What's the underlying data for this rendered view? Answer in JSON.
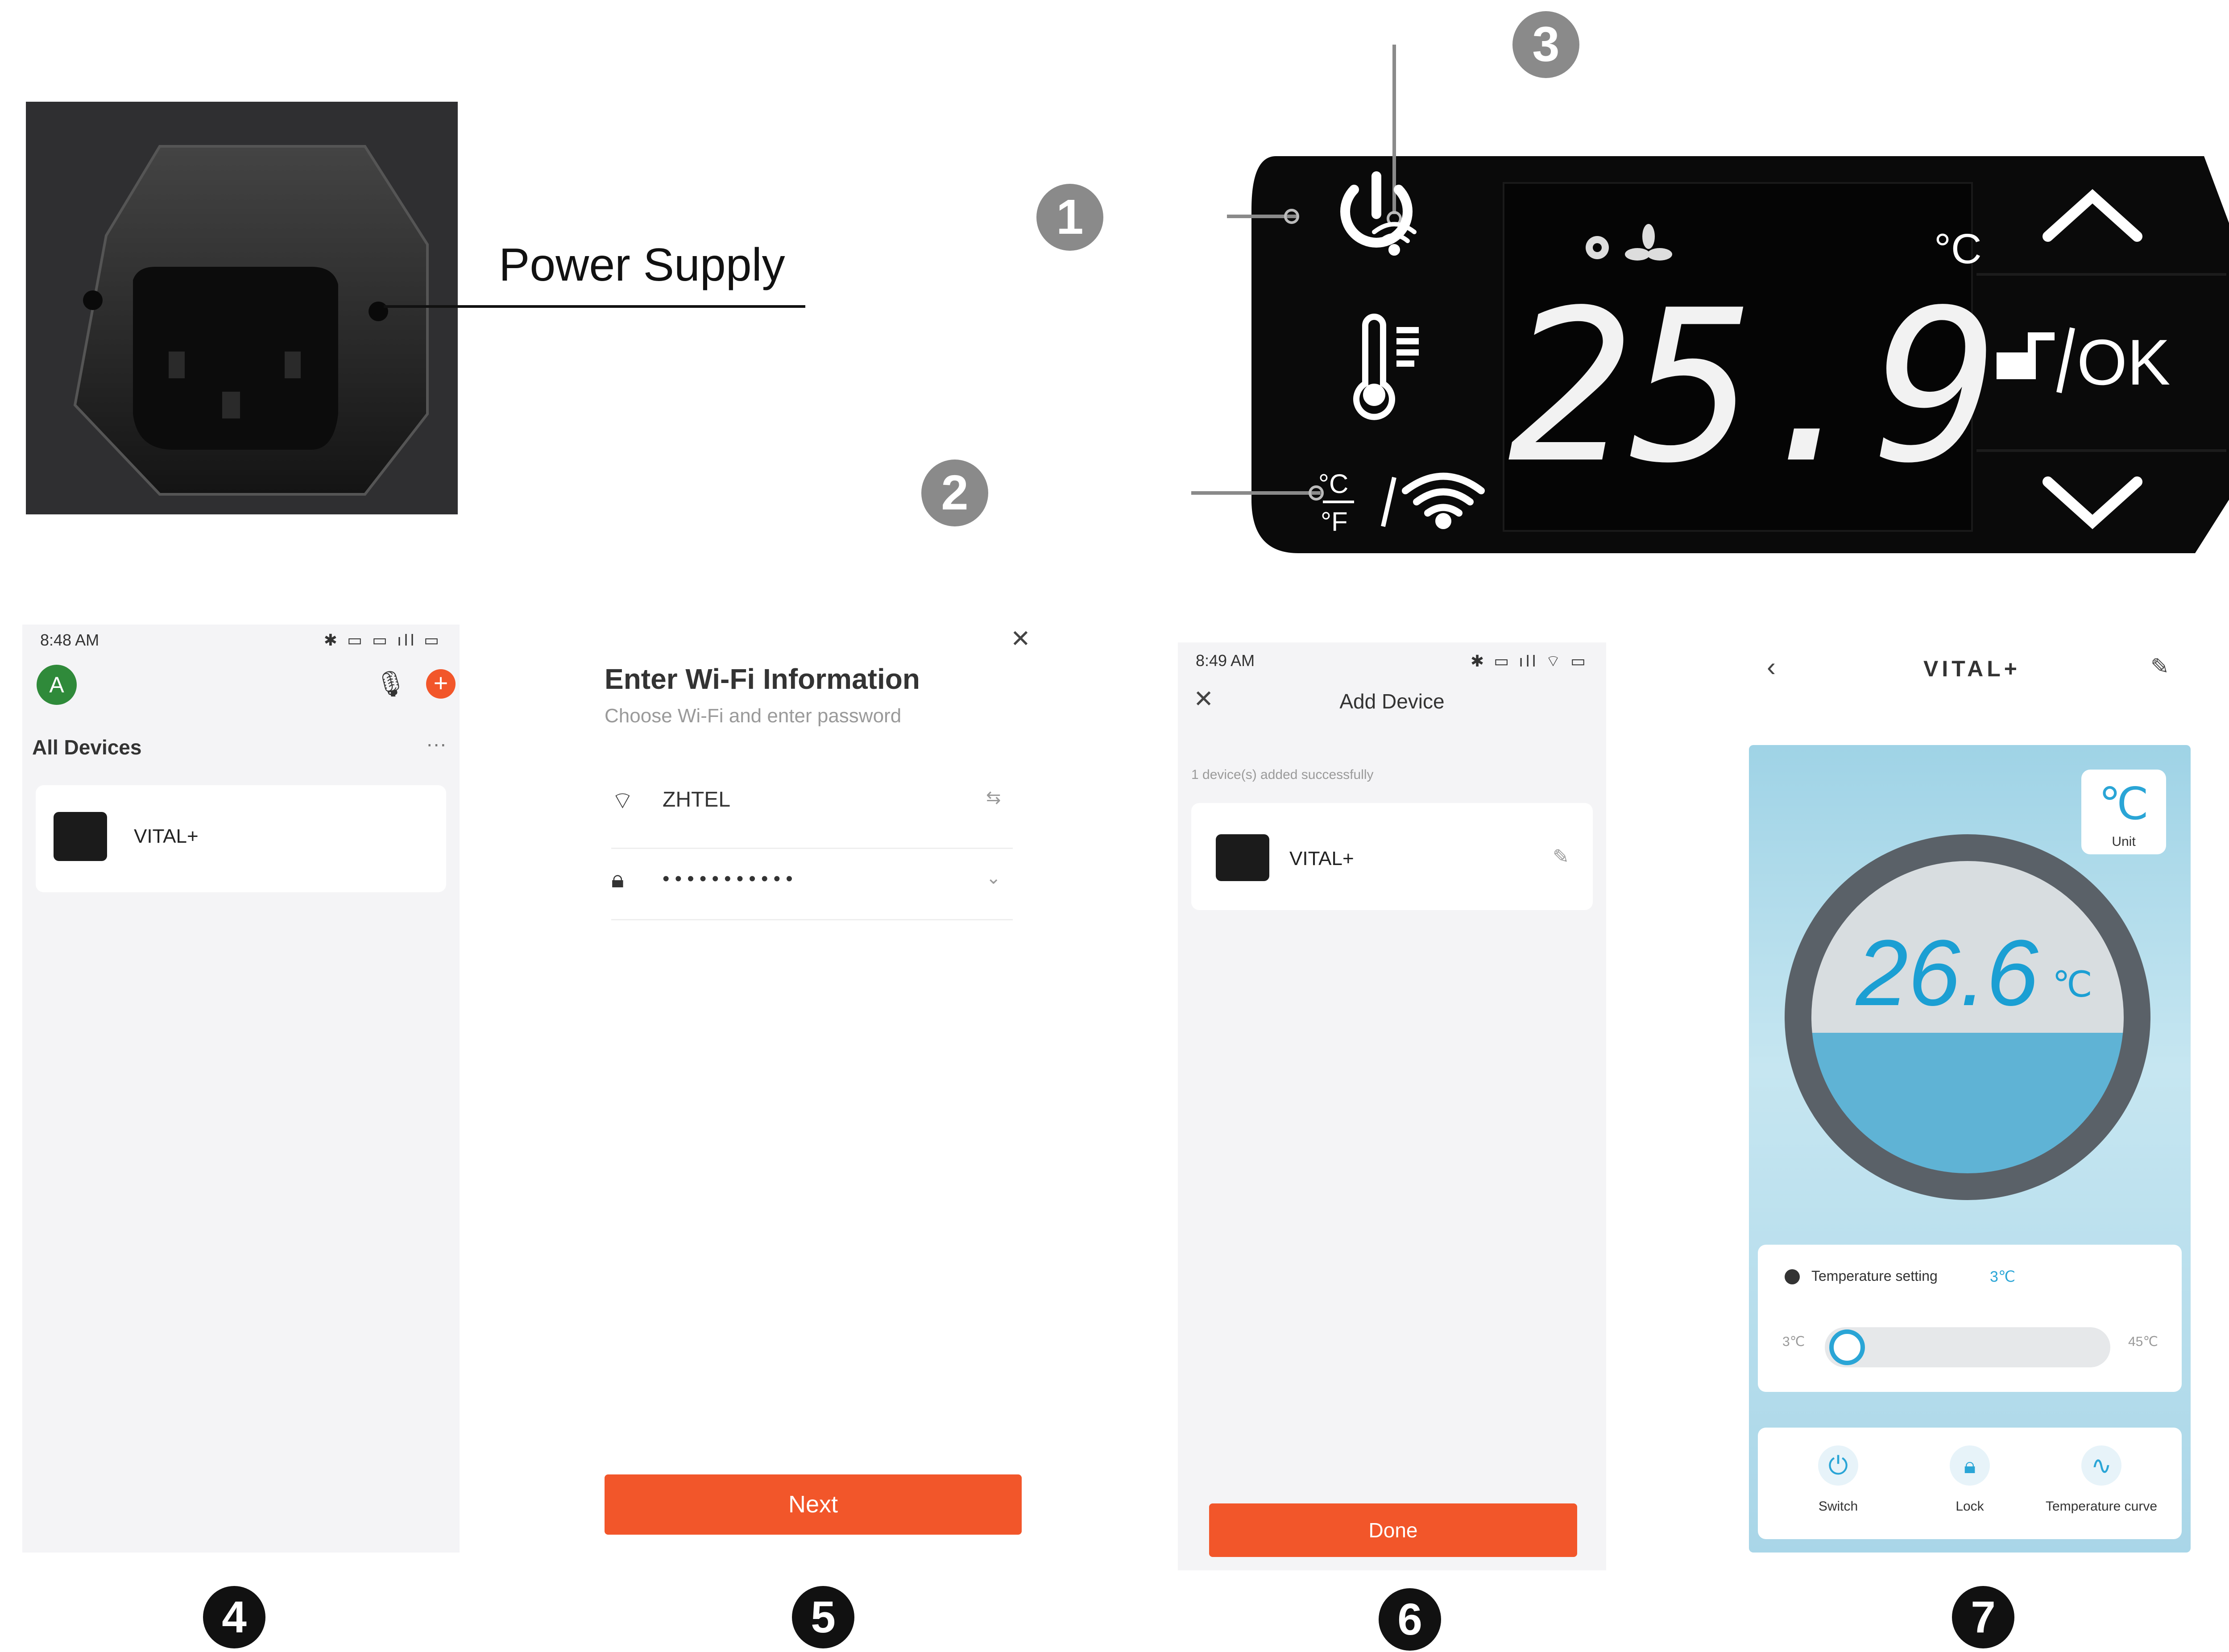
{
  "power_supply": {
    "label": "Power Supply"
  },
  "controller": {
    "display_value": "25.9",
    "unit_symbol": "°C",
    "ok_label": "OK",
    "unit_toggle_c": "°C",
    "unit_toggle_f": "°F",
    "callouts": [
      "1",
      "2",
      "3"
    ]
  },
  "screen4": {
    "status_time": "8:48 AM",
    "avatar_letter": "A",
    "section_title": "All Devices",
    "more": "···",
    "device_name": "VITAL+"
  },
  "screen5": {
    "title": "Enter Wi-Fi Information",
    "subtitle": "Choose Wi-Fi and enter password",
    "wifi_name": "ZHTEL",
    "password_mask": "• • • • • • • • • • •",
    "next_label": "Next"
  },
  "screen6": {
    "status_time": "8:49 AM",
    "title": "Add Device",
    "success_text": "1 device(s) added successfully",
    "device_name": "VITAL+",
    "done_label": "Done"
  },
  "screen7": {
    "title": "VITAL+",
    "unit_symbol": "℃",
    "unit_label": "Unit",
    "temperature": "26.6",
    "temp_unit": "℃",
    "setting_label": "Temperature setting",
    "setting_value": "3℃",
    "range_min": "3℃",
    "range_max": "45℃",
    "slider_fraction": 0.0,
    "buttons": [
      {
        "label": "Switch",
        "icon": "power-icon"
      },
      {
        "label": "Lock",
        "icon": "lock-icon"
      },
      {
        "label": "Temperature curve",
        "icon": "pulse-icon"
      }
    ]
  },
  "step_numbers": [
    "4",
    "5",
    "6",
    "7"
  ]
}
